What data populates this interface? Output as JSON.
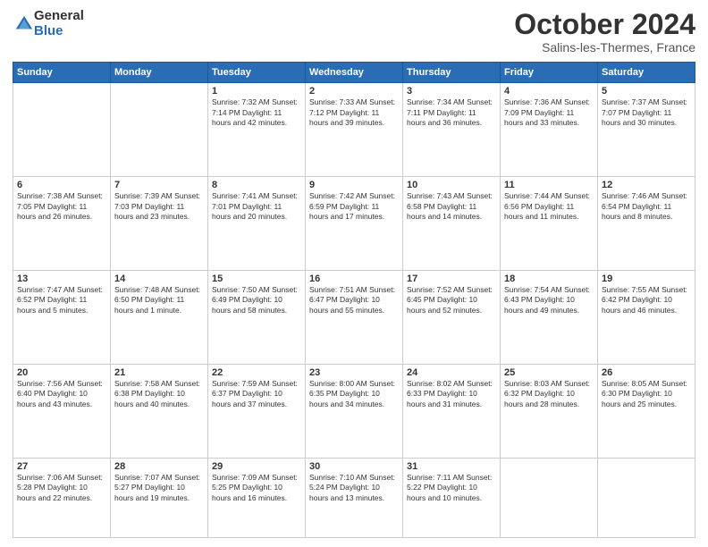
{
  "logo": {
    "general": "General",
    "blue": "Blue"
  },
  "header": {
    "month": "October 2024",
    "location": "Salins-les-Thermes, France"
  },
  "weekdays": [
    "Sunday",
    "Monday",
    "Tuesday",
    "Wednesday",
    "Thursday",
    "Friday",
    "Saturday"
  ],
  "weeks": [
    [
      {
        "day": "",
        "info": ""
      },
      {
        "day": "",
        "info": ""
      },
      {
        "day": "1",
        "info": "Sunrise: 7:32 AM\nSunset: 7:14 PM\nDaylight: 11 hours\nand 42 minutes."
      },
      {
        "day": "2",
        "info": "Sunrise: 7:33 AM\nSunset: 7:12 PM\nDaylight: 11 hours\nand 39 minutes."
      },
      {
        "day": "3",
        "info": "Sunrise: 7:34 AM\nSunset: 7:11 PM\nDaylight: 11 hours\nand 36 minutes."
      },
      {
        "day": "4",
        "info": "Sunrise: 7:36 AM\nSunset: 7:09 PM\nDaylight: 11 hours\nand 33 minutes."
      },
      {
        "day": "5",
        "info": "Sunrise: 7:37 AM\nSunset: 7:07 PM\nDaylight: 11 hours\nand 30 minutes."
      }
    ],
    [
      {
        "day": "6",
        "info": "Sunrise: 7:38 AM\nSunset: 7:05 PM\nDaylight: 11 hours\nand 26 minutes."
      },
      {
        "day": "7",
        "info": "Sunrise: 7:39 AM\nSunset: 7:03 PM\nDaylight: 11 hours\nand 23 minutes."
      },
      {
        "day": "8",
        "info": "Sunrise: 7:41 AM\nSunset: 7:01 PM\nDaylight: 11 hours\nand 20 minutes."
      },
      {
        "day": "9",
        "info": "Sunrise: 7:42 AM\nSunset: 6:59 PM\nDaylight: 11 hours\nand 17 minutes."
      },
      {
        "day": "10",
        "info": "Sunrise: 7:43 AM\nSunset: 6:58 PM\nDaylight: 11 hours\nand 14 minutes."
      },
      {
        "day": "11",
        "info": "Sunrise: 7:44 AM\nSunset: 6:56 PM\nDaylight: 11 hours\nand 11 minutes."
      },
      {
        "day": "12",
        "info": "Sunrise: 7:46 AM\nSunset: 6:54 PM\nDaylight: 11 hours\nand 8 minutes."
      }
    ],
    [
      {
        "day": "13",
        "info": "Sunrise: 7:47 AM\nSunset: 6:52 PM\nDaylight: 11 hours\nand 5 minutes."
      },
      {
        "day": "14",
        "info": "Sunrise: 7:48 AM\nSunset: 6:50 PM\nDaylight: 11 hours\nand 1 minute."
      },
      {
        "day": "15",
        "info": "Sunrise: 7:50 AM\nSunset: 6:49 PM\nDaylight: 10 hours\nand 58 minutes."
      },
      {
        "day": "16",
        "info": "Sunrise: 7:51 AM\nSunset: 6:47 PM\nDaylight: 10 hours\nand 55 minutes."
      },
      {
        "day": "17",
        "info": "Sunrise: 7:52 AM\nSunset: 6:45 PM\nDaylight: 10 hours\nand 52 minutes."
      },
      {
        "day": "18",
        "info": "Sunrise: 7:54 AM\nSunset: 6:43 PM\nDaylight: 10 hours\nand 49 minutes."
      },
      {
        "day": "19",
        "info": "Sunrise: 7:55 AM\nSunset: 6:42 PM\nDaylight: 10 hours\nand 46 minutes."
      }
    ],
    [
      {
        "day": "20",
        "info": "Sunrise: 7:56 AM\nSunset: 6:40 PM\nDaylight: 10 hours\nand 43 minutes."
      },
      {
        "day": "21",
        "info": "Sunrise: 7:58 AM\nSunset: 6:38 PM\nDaylight: 10 hours\nand 40 minutes."
      },
      {
        "day": "22",
        "info": "Sunrise: 7:59 AM\nSunset: 6:37 PM\nDaylight: 10 hours\nand 37 minutes."
      },
      {
        "day": "23",
        "info": "Sunrise: 8:00 AM\nSunset: 6:35 PM\nDaylight: 10 hours\nand 34 minutes."
      },
      {
        "day": "24",
        "info": "Sunrise: 8:02 AM\nSunset: 6:33 PM\nDaylight: 10 hours\nand 31 minutes."
      },
      {
        "day": "25",
        "info": "Sunrise: 8:03 AM\nSunset: 6:32 PM\nDaylight: 10 hours\nand 28 minutes."
      },
      {
        "day": "26",
        "info": "Sunrise: 8:05 AM\nSunset: 6:30 PM\nDaylight: 10 hours\nand 25 minutes."
      }
    ],
    [
      {
        "day": "27",
        "info": "Sunrise: 7:06 AM\nSunset: 5:28 PM\nDaylight: 10 hours\nand 22 minutes."
      },
      {
        "day": "28",
        "info": "Sunrise: 7:07 AM\nSunset: 5:27 PM\nDaylight: 10 hours\nand 19 minutes."
      },
      {
        "day": "29",
        "info": "Sunrise: 7:09 AM\nSunset: 5:25 PM\nDaylight: 10 hours\nand 16 minutes."
      },
      {
        "day": "30",
        "info": "Sunrise: 7:10 AM\nSunset: 5:24 PM\nDaylight: 10 hours\nand 13 minutes."
      },
      {
        "day": "31",
        "info": "Sunrise: 7:11 AM\nSunset: 5:22 PM\nDaylight: 10 hours\nand 10 minutes."
      },
      {
        "day": "",
        "info": ""
      },
      {
        "day": "",
        "info": ""
      }
    ]
  ]
}
